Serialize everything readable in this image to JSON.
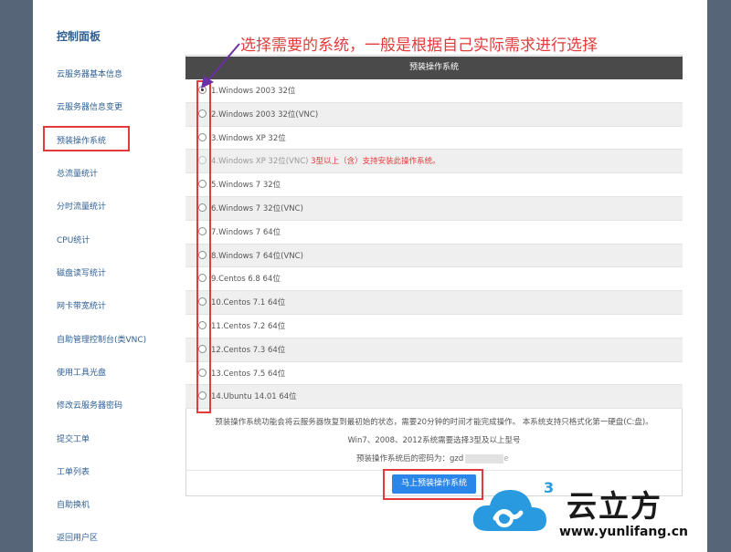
{
  "sidebar": {
    "title": "控制面板",
    "items": [
      {
        "label": "云服务器基本信息"
      },
      {
        "label": "云服务器信息变更"
      },
      {
        "label": "预装操作系统"
      },
      {
        "label": "总流量统计"
      },
      {
        "label": "分时流量统计"
      },
      {
        "label": "CPU统计"
      },
      {
        "label": "磁盘读写统计"
      },
      {
        "label": "网卡带宽统计"
      },
      {
        "label": "自助管理控制台(类VNC)"
      },
      {
        "label": "使用工具光盘"
      },
      {
        "label": "修改云服务器密码"
      },
      {
        "label": "提交工单"
      },
      {
        "label": "工单列表"
      },
      {
        "label": "自助换机"
      },
      {
        "label": "返回用户区"
      }
    ]
  },
  "annotation": "选择需要的系统，一般是根据自己实际需求进行选择",
  "panel": {
    "header": "预装操作系统",
    "options": [
      {
        "label": "1.Windows 2003 32位",
        "checked": true
      },
      {
        "label": "2.Windows 2003 32位(VNC)"
      },
      {
        "label": "3.Windows XP 32位"
      },
      {
        "label": "4.Windows XP 32位(VNC)",
        "disabled": true,
        "warning": "3型以上（含）支持安装此操作系统。"
      },
      {
        "label": "5.Windows 7 32位"
      },
      {
        "label": "6.Windows 7 32位(VNC)"
      },
      {
        "label": "7.Windows 7 64位"
      },
      {
        "label": "8.Windows 7 64位(VNC)"
      },
      {
        "label": "9.Centos 6.8 64位"
      },
      {
        "label": "10.Centos 7.1 64位"
      },
      {
        "label": "11.Centos 7.2 64位"
      },
      {
        "label": "12.Centos 7.3 64位"
      },
      {
        "label": "13.Centos 7.5 64位"
      },
      {
        "label": "14.Ubuntu 14.01 64位"
      }
    ],
    "note_line1": "预装操作系统功能会将云服务器恢复到最初始的状态，需要20分钟的时间才能完成操作。 本系统支持只格式化第一硬盘(C:盘)。",
    "note_line2": "Win7、2008、2012系统需要选择3型及以上型号",
    "password_label": "预装操作系统后的密码为：",
    "password_visible": "gzd",
    "password_tail": "e",
    "submit_label": "马上预装操作系统"
  },
  "brand": {
    "name": "云立方",
    "url": "www.yunlifang.cn",
    "logo_number": "3"
  },
  "colors": {
    "accent_red": "#e23b3b",
    "button_blue": "#2a86e8",
    "sidebar_link": "#2f5f93",
    "header_dark": "#4a4a4a",
    "logo_blue": "#2a9ae0"
  }
}
